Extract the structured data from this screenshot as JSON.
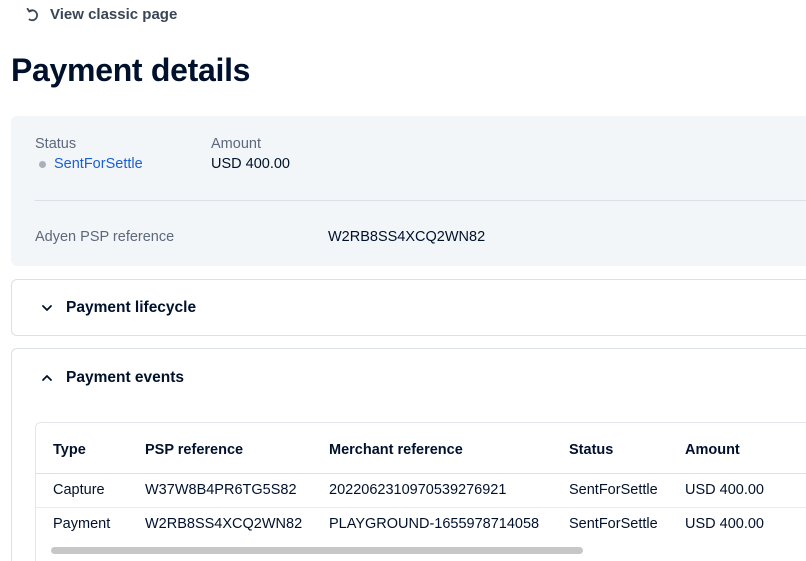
{
  "nav": {
    "back_label": "View classic page",
    "back_icon": "undo-arrow-icon"
  },
  "page": {
    "title": "Payment details"
  },
  "summary": {
    "status_label": "Status",
    "status_value": "SentForSettle",
    "amount_label": "Amount",
    "amount_value": "USD 400.00",
    "psp_label": "Adyen PSP reference",
    "psp_value": "W2RB8SS4XCQ2WN82"
  },
  "sections": {
    "lifecycle": {
      "title": "Payment lifecycle",
      "icon": "chevron-down-icon",
      "expanded": false
    },
    "events": {
      "title": "Payment events",
      "icon": "chevron-up-icon",
      "expanded": true
    }
  },
  "events_table": {
    "headers": [
      "Type",
      "PSP reference",
      "Merchant reference",
      "Status",
      "Amount"
    ],
    "rows": [
      [
        "Capture",
        "W37W8B4PR6TG5S82",
        "2022062310970539276921",
        "SentForSettle",
        "USD 400.00"
      ],
      [
        "Payment",
        "W2RB8SS4XCQ2WN82",
        "PLAYGROUND-1655978714058",
        "SentForSettle",
        "USD 400.00"
      ]
    ]
  },
  "colors": {
    "status_link": "#1b5fd1",
    "summary_bg": "#f3f6f9",
    "text": "#00112c"
  }
}
